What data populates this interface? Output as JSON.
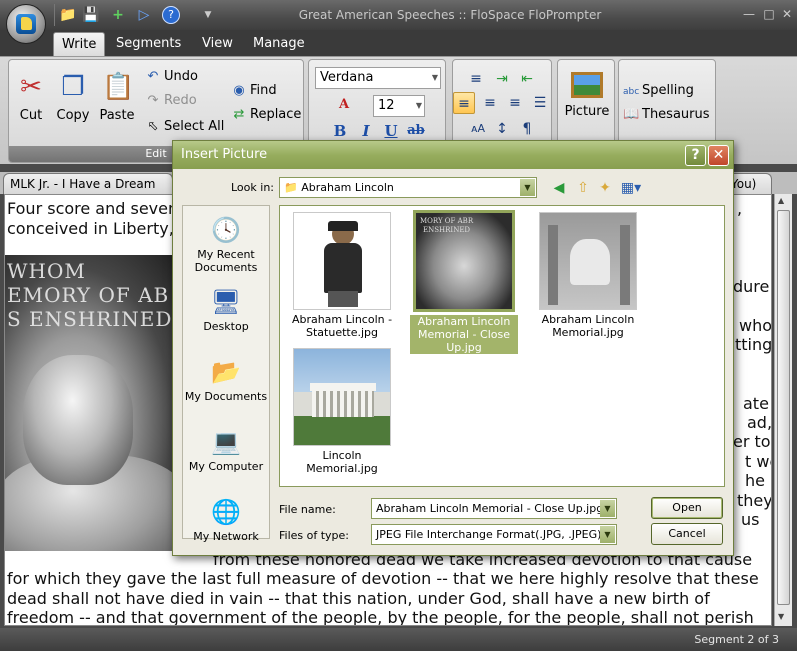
{
  "app": {
    "title": "Great American Speeches :: FloSpace FloPrompter",
    "menu": [
      "Write",
      "Segments",
      "View",
      "Manage"
    ],
    "active_menu": "Write"
  },
  "ribbon": {
    "edit_group": {
      "caption": "Edit",
      "cut": "Cut",
      "copy": "Copy",
      "paste": "Paste",
      "undo": "Undo",
      "redo": "Redo",
      "select_all": "Select All",
      "find": "Find",
      "replace": "Replace"
    },
    "font": {
      "name": "Verdana",
      "size": "12"
    },
    "picture": "Picture",
    "spelling": "Spelling",
    "thesaurus": "Thesaurus"
  },
  "document": {
    "tab_title": "MLK Jr. - I Have a Dream",
    "tab_title_right": "You)",
    "lines_top": [
      "Four score and seven",
      "conceived in Liberty,"
    ],
    "right_fragments": [
      ",",
      "dure.",
      "who",
      "tting",
      "ate",
      "ad,",
      "er to",
      "t we",
      "he",
      "they",
      "us"
    ],
    "lines_bottom": [
      "from these honored dead we take increased devotion to that cause",
      "for which they gave the last full measure of devotion -- that we here highly resolve that these",
      "dead shall not have died in vain -- that this nation, under God, shall have a new birth of",
      "freedom -- and that government of the people, by the people, for the people, shall not perish"
    ],
    "image_inscription": [
      "WHOM",
      "EMORY OF AB",
      "S ENSHRINED"
    ]
  },
  "status": {
    "segment": "Segment 2 of 3"
  },
  "dialog": {
    "title": "Insert Picture",
    "look_in_label": "Look in:",
    "look_in_value": "Abraham Lincoln",
    "places": [
      "My Recent Documents",
      "Desktop",
      "My Documents",
      "My Computer",
      "My Network"
    ],
    "files": [
      "Abraham Lincoln - Statuette.jpg",
      "Abraham Lincoln Memorial - Close Up.jpg",
      "Abraham Lincoln Memorial.jpg",
      "Lincoln Memorial.jpg"
    ],
    "selected_file_index": 1,
    "file_name_label": "File name:",
    "file_name_value": "Abraham Lincoln Memorial - Close Up.jpg",
    "file_type_label": "Files of type:",
    "file_type_value": "JPEG File Interchange Format(.JPG, .JPEG)",
    "open_label": "Open",
    "cancel_label": "Cancel"
  },
  "colors": {
    "dialog_accent": "#97ad5e",
    "selection": "#a3b46a",
    "chrome_dark": "#3a3a3a"
  }
}
